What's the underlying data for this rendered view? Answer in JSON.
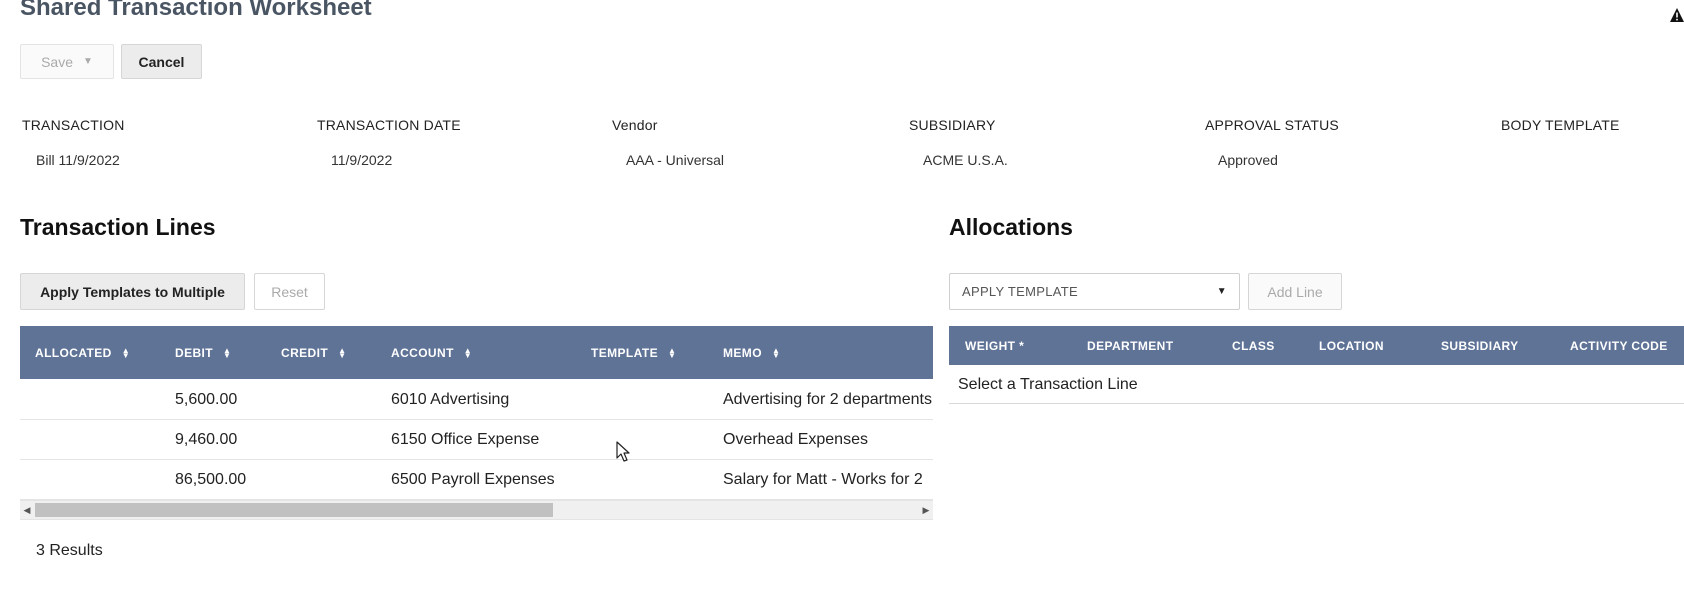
{
  "page": {
    "title": "Shared Transaction Worksheet"
  },
  "toolbar": {
    "save_label": "Save",
    "cancel_label": "Cancel"
  },
  "fields": [
    {
      "label": "TRANSACTION",
      "value": "Bill 11/9/2022"
    },
    {
      "label": "TRANSACTION DATE",
      "value": "11/9/2022"
    },
    {
      "label": "Vendor",
      "value": "AAA - Universal"
    },
    {
      "label": "SUBSIDIARY",
      "value": "ACME U.S.A."
    },
    {
      "label": "APPROVAL STATUS",
      "value": "Approved"
    },
    {
      "label": "BODY TEMPLATE",
      "value": ""
    }
  ],
  "transaction_lines": {
    "title": "Transaction Lines",
    "apply_multiple_label": "Apply Templates to Multiple",
    "reset_label": "Reset",
    "columns": [
      "ALLOCATED",
      "DEBIT",
      "CREDIT",
      "ACCOUNT",
      "TEMPLATE",
      "MEMO"
    ],
    "rows": [
      {
        "allocated": "",
        "debit": "5,600.00",
        "credit": "",
        "account": "6010 Advertising",
        "template": "",
        "memo": "Advertising for 2 departments"
      },
      {
        "allocated": "",
        "debit": "9,460.00",
        "credit": "",
        "account": "6150 Office Expense",
        "template": "",
        "memo": "Overhead Expenses"
      },
      {
        "allocated": "",
        "debit": "86,500.00",
        "credit": "",
        "account": "6500 Payroll Expenses",
        "template": "",
        "memo": "Salary for Matt - Works for 2"
      }
    ],
    "results_label": "3 Results"
  },
  "allocations": {
    "title": "Allocations",
    "apply_template_placeholder": "APPLY TEMPLATE",
    "add_line_label": "Add Line",
    "columns": [
      "WEIGHT *",
      "DEPARTMENT",
      "CLASS",
      "LOCATION",
      "SUBSIDIARY",
      "ACTIVITY CODE"
    ],
    "empty_message": "Select a Transaction Line"
  },
  "colors": {
    "header_bg": "#5f7397",
    "title": "#4a5563"
  }
}
